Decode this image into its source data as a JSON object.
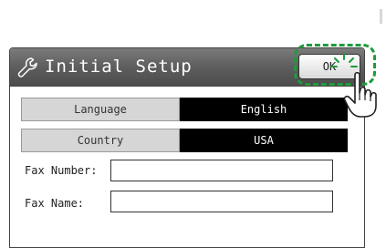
{
  "dialog": {
    "title": "Initial Setup",
    "ok_label": "OK",
    "title_icon": "wrench-icon"
  },
  "settings": [
    {
      "label": "Language",
      "value": "English"
    },
    {
      "label": "Country",
      "value": "USA"
    }
  ],
  "fields": [
    {
      "label": "Fax Number:",
      "value": ""
    },
    {
      "label": "Fax Name:",
      "value": ""
    }
  ],
  "callout": {
    "highlight_color": "#1e9b3c",
    "pointer_icon": "hand-pointer-icon"
  }
}
